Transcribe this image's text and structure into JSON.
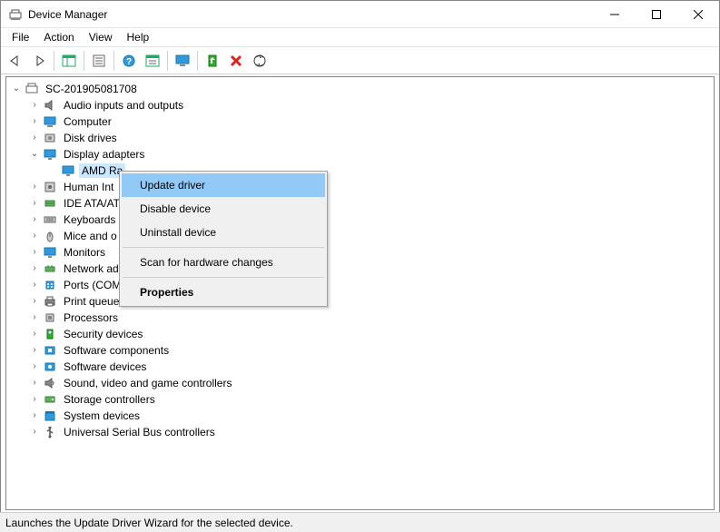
{
  "window": {
    "title": "Device Manager"
  },
  "menubar": {
    "items": [
      "File",
      "Action",
      "View",
      "Help"
    ]
  },
  "tree": {
    "root": "SC-201905081708",
    "display_adapters_label": "Display adapters",
    "amd_device": "AMD Ra",
    "nodes": [
      {
        "label": "Audio inputs and outputs",
        "icon": "speaker"
      },
      {
        "label": "Computer",
        "icon": "computer"
      },
      {
        "label": "Disk drives",
        "icon": "disk"
      },
      {
        "label": "Human Int",
        "icon": "hid"
      },
      {
        "label": "IDE ATA/AT",
        "icon": "ide"
      },
      {
        "label": "Keyboards",
        "icon": "keyboard"
      },
      {
        "label": "Mice and o",
        "icon": "mouse"
      },
      {
        "label": "Monitors",
        "icon": "monitor"
      },
      {
        "label": "Network ad",
        "icon": "network"
      },
      {
        "label": "Ports (COM & LPT)",
        "icon": "port"
      },
      {
        "label": "Print queues",
        "icon": "printer"
      },
      {
        "label": "Processors",
        "icon": "cpu"
      },
      {
        "label": "Security devices",
        "icon": "security"
      },
      {
        "label": "Software components",
        "icon": "swcomp"
      },
      {
        "label": "Software devices",
        "icon": "swdev"
      },
      {
        "label": "Sound, video and game controllers",
        "icon": "sound"
      },
      {
        "label": "Storage controllers",
        "icon": "storage"
      },
      {
        "label": "System devices",
        "icon": "system"
      },
      {
        "label": "Universal Serial Bus controllers",
        "icon": "usb"
      }
    ]
  },
  "context_menu": {
    "items": [
      {
        "label": "Update driver",
        "highlighted": true
      },
      {
        "label": "Disable device"
      },
      {
        "label": "Uninstall device"
      },
      {
        "sep": true
      },
      {
        "label": "Scan for hardware changes"
      },
      {
        "sep": true
      },
      {
        "label": "Properties",
        "bold": true
      }
    ]
  },
  "statusbar": {
    "text": "Launches the Update Driver Wizard for the selected device."
  },
  "toolbar": {
    "buttons": [
      {
        "name": "back-button",
        "icon": "arrow-left"
      },
      {
        "name": "forward-button",
        "icon": "arrow-right"
      },
      {
        "sep": true
      },
      {
        "name": "show-hide-tree-button",
        "icon": "panel"
      },
      {
        "sep": true
      },
      {
        "name": "properties-button",
        "icon": "props"
      },
      {
        "sep": true
      },
      {
        "name": "help-button",
        "icon": "help"
      },
      {
        "name": "options-button",
        "icon": "opts"
      },
      {
        "sep": true
      },
      {
        "name": "monitor-button",
        "icon": "monitor"
      },
      {
        "sep": true
      },
      {
        "name": "update-driver-button",
        "icon": "update"
      },
      {
        "name": "uninstall-button",
        "icon": "uninstall"
      },
      {
        "name": "scan-button",
        "icon": "scan"
      }
    ]
  }
}
